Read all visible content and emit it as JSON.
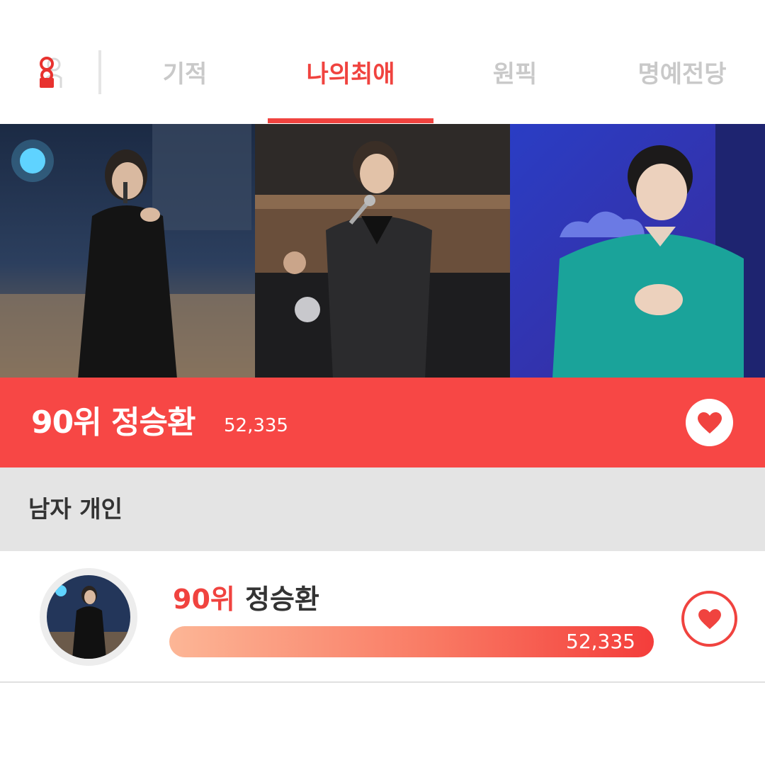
{
  "nav": {
    "logo_icon": "fan-user-icon",
    "tabs": [
      {
        "label": "기적",
        "active": false
      },
      {
        "label": "나의최애",
        "active": true
      },
      {
        "label": "원픽",
        "active": false
      },
      {
        "label": "명예전당",
        "active": false
      }
    ]
  },
  "banner": {
    "rank": "90위",
    "name": "정승환",
    "count": "52,335",
    "heart_icon": "heart-icon"
  },
  "category": {
    "title": "남자 개인"
  },
  "row": {
    "rank": "90위",
    "name": "정승환",
    "votes": "52,335",
    "heart_icon": "heart-icon"
  },
  "colors": {
    "accent": "#f0433f",
    "banner_bg": "#f74745",
    "category_bg": "#e4e4e4",
    "tab_inactive": "#c9c9c9",
    "bar_start": "#fcb696",
    "bar_end": "#f43d3b"
  }
}
